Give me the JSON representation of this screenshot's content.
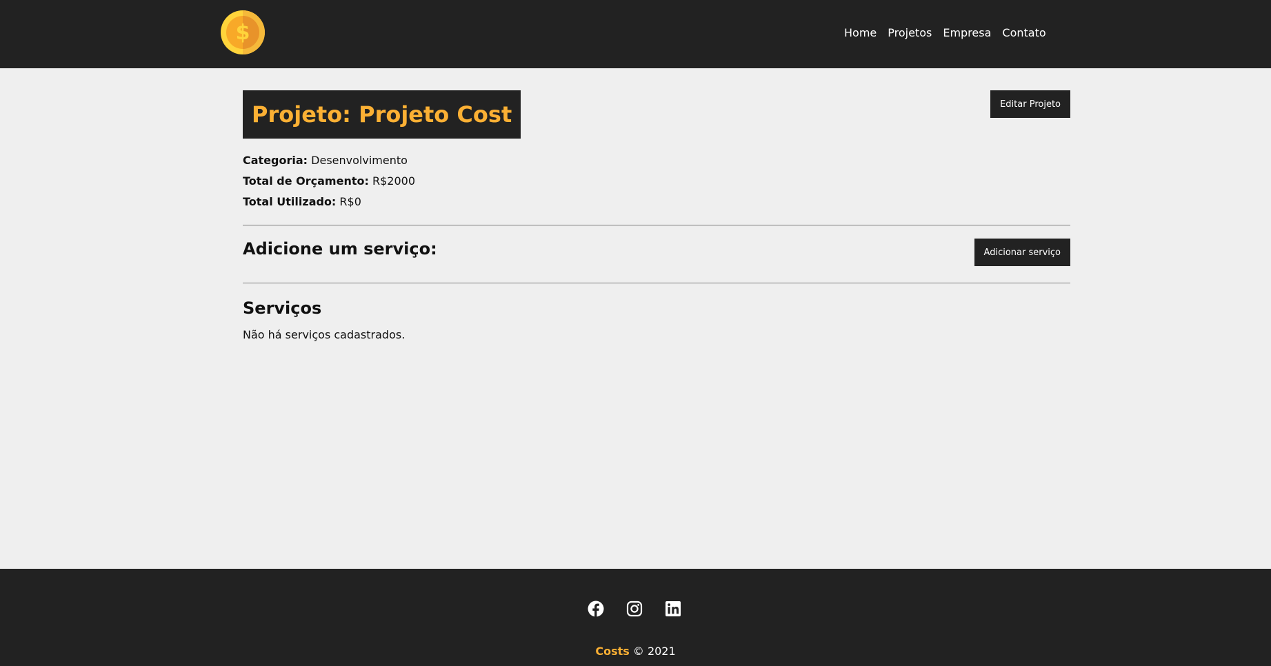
{
  "header": {
    "logo_icon": "coin-dollar-icon",
    "nav": [
      {
        "label": "Home"
      },
      {
        "label": "Projetos"
      },
      {
        "label": "Empresa"
      },
      {
        "label": "Contato"
      }
    ]
  },
  "project": {
    "title": "Projeto: Projeto Cost",
    "edit_button": "Editar Projeto",
    "info": [
      {
        "label": "Categoria:",
        "value": "Desenvolvimento"
      },
      {
        "label": "Total de Orçamento:",
        "value": "R$2000"
      },
      {
        "label": "Total Utilizado:",
        "value": "R$0"
      }
    ]
  },
  "service_form": {
    "title": "Adicione um serviço:",
    "add_button": "Adicionar serviço"
  },
  "services": {
    "title": "Serviços",
    "empty_message": "Não há serviços cadastrados."
  },
  "footer": {
    "social": [
      {
        "icon": "facebook-icon"
      },
      {
        "icon": "instagram-icon"
      },
      {
        "icon": "linkedin-icon"
      }
    ],
    "brand": "Costs",
    "copyright": "© 2021"
  },
  "colors": {
    "dark": "#222222",
    "accent": "#fbb034",
    "background": "#efefef"
  }
}
